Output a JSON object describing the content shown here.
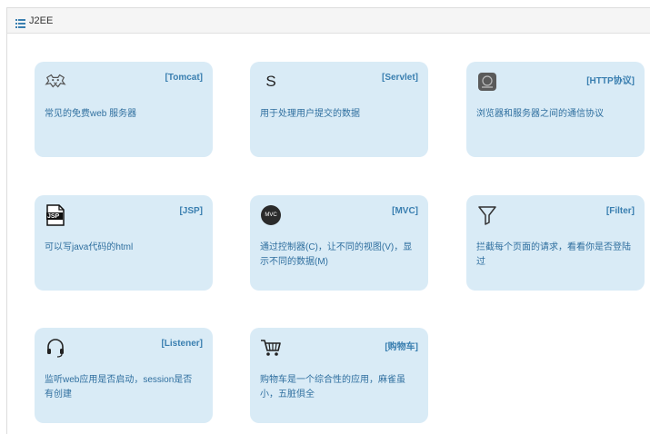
{
  "header": {
    "title": "J2EE",
    "icon": "list-icon"
  },
  "colors": {
    "card_bg": "#d9ebf6",
    "title_color": "#3a7fb0",
    "desc_color": "#2f6f9f"
  },
  "cards": [
    {
      "title": "[Tomcat]",
      "desc": "常见的免费web 服务器",
      "icon": "tomcat-icon"
    },
    {
      "title": "[Servlet]",
      "desc": "用于处理用户提交的数据",
      "icon": "servlet-icon",
      "icon_text": "S"
    },
    {
      "title": "[HTTP协议]",
      "desc": "浏览器和服务器之间的通信协议",
      "icon": "http-icon"
    },
    {
      "title": "[JSP]",
      "desc": "可以写java代码的html",
      "icon": "jsp-file-icon",
      "icon_text": "JSP"
    },
    {
      "title": "[MVC]",
      "desc": "通过控制器(C)，让不同的视图(V)，显示不同的数据(M)",
      "icon": "mvc-icon",
      "icon_text": "MVC"
    },
    {
      "title": "[Filter]",
      "desc": "拦截每个页面的请求，看看你是否登陆过",
      "icon": "filter-icon"
    },
    {
      "title": "[Listener]",
      "desc": "监听web应用是否启动，session是否有创建",
      "icon": "headset-icon"
    },
    {
      "title": "[购物车]",
      "desc": "购物车是一个综合性的应用，麻雀虽小，五脏俱全",
      "icon": "shopping-cart-icon"
    }
  ]
}
